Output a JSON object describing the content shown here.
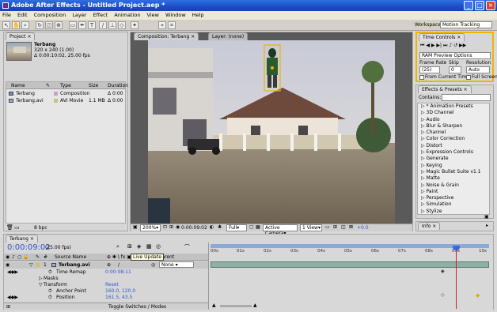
{
  "app": {
    "title": "Adobe After Effects - Untitled Project.aep *"
  },
  "menu": [
    "File",
    "Edit",
    "Composition",
    "Layer",
    "Effect",
    "Animation",
    "View",
    "Window",
    "Help"
  ],
  "workspace": {
    "label": "Workspace:",
    "value": "Motion Tracking"
  },
  "project": {
    "tab": "Project",
    "comp_name": "Terbang",
    "comp_info1": "320 x 240 (1.00)",
    "comp_info2": "Δ 0:00:10:02, 25.00 fps",
    "headers": {
      "name": "Name",
      "type": "Type",
      "size": "Size",
      "duration": "Duration"
    },
    "items": [
      {
        "name": "Terbang",
        "type": "Composition",
        "size": "",
        "duration": "Δ 0:00"
      },
      {
        "name": "Terbang.avi",
        "type": "AVI Movie",
        "size": "1.1 MB",
        "duration": "Δ 0:00"
      }
    ],
    "bpc": "8 bpc"
  },
  "viewer": {
    "comp_tab": "Composition: Terbang",
    "layer_tab": "Layer: (none)",
    "zoom": "200%",
    "timecode": "0:00:09:02",
    "resolution": "Full",
    "camera": "Active Camera",
    "views": "1 View",
    "exposure": "+0.0"
  },
  "time_controls": {
    "tab": "Time Controls",
    "ram_preview": "RAM Preview Options",
    "frame_rate_label": "Frame Rate",
    "skip_label": "Skip",
    "resolution_label": "Resolution",
    "frame_rate": "(25)",
    "skip": "0",
    "resolution": "Auto",
    "from_current": "From Current Time",
    "full_screen": "Full Screen"
  },
  "effects": {
    "tab": "Effects & Presets",
    "contains": "Contains:",
    "items": [
      "* Animation Presets",
      "3D Channel",
      "Audio",
      "Blur & Sharpen",
      "Channel",
      "Color Correction",
      "Distort",
      "Expression Controls",
      "Generate",
      "Keying",
      "Magic Bullet Suite v1.1",
      "Matte",
      "Noise & Grain",
      "Paint",
      "Perspective",
      "Simulation",
      "Stylize"
    ]
  },
  "info": {
    "tab": "Info"
  },
  "timeline": {
    "tab": "Terbang",
    "timecode": "0:00:09:02",
    "fps": "(25.00 fps)",
    "source_name": "Source Name",
    "parent": "Parent",
    "parent_value": "None",
    "tooltip": "Live Update",
    "layer_num": "1",
    "layer_name": "Terbang.avi",
    "props": [
      {
        "name": "Time Remap",
        "value": "0:00:08:11"
      },
      {
        "name": "Masks",
        "value": ""
      },
      {
        "name": "Transform",
        "value": "Reset"
      },
      {
        "name": "Anchor Point",
        "value": "160.0, 120.0"
      },
      {
        "name": "Position",
        "value": "161.5, 43.5"
      }
    ],
    "ticks": [
      "00s",
      "01s",
      "02s",
      "03s",
      "04s",
      "05s",
      "06s",
      "07s",
      "08s",
      "09s",
      "10s"
    ],
    "toggle": "Toggle Switches / Modes"
  },
  "colors": {
    "accent_yellow": "#f0b400",
    "titlebar_blue": "#1a4fc4",
    "timecode_blue": "#3355cc",
    "playhead": "#cc2222"
  }
}
